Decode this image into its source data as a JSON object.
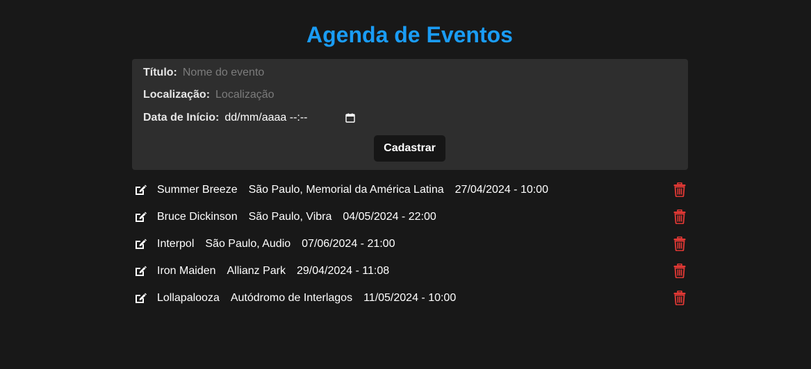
{
  "header": {
    "title": "Agenda de Eventos"
  },
  "form": {
    "title_label": "Título:",
    "title_placeholder": "Nome do evento",
    "location_label": "Localização:",
    "location_placeholder": "Localização",
    "date_label": "Data de Início:",
    "date_value": "dd/mm/aaaa --:--",
    "submit_label": "Cadastrar"
  },
  "events": [
    {
      "name": "Summer Breeze",
      "location": "São Paulo, Memorial da América Latina",
      "datetime": "27/04/2024 - 10:00"
    },
    {
      "name": "Bruce Dickinson",
      "location": "São Paulo, Vibra",
      "datetime": "04/05/2024 - 22:00"
    },
    {
      "name": "Interpol",
      "location": "São Paulo, Audio",
      "datetime": "07/06/2024 - 21:00"
    },
    {
      "name": "Iron Maiden",
      "location": "Allianz Park",
      "datetime": "29/04/2024 - 11:08"
    },
    {
      "name": "Lollapalooza",
      "location": "Autódromo de Interlagos",
      "datetime": "11/05/2024 - 10:00"
    }
  ],
  "icons": {
    "edit": "edit-icon",
    "delete": "trash-icon",
    "calendar": "calendar-icon"
  },
  "colors": {
    "accent": "#1a9cf5",
    "danger": "#e53935",
    "background": "#181818",
    "panel": "#2e2e2e"
  }
}
